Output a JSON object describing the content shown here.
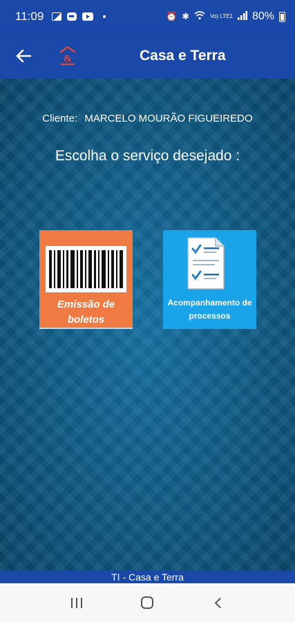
{
  "status_bar": {
    "time": "11:09",
    "battery": "80%",
    "network": "Vo) LTE1",
    "icons": [
      "gallery-icon",
      "app-icon",
      "youtube-icon",
      "alarm-icon",
      "bluetooth-icon",
      "wifi-icon",
      "signal-icon",
      "battery-icon"
    ]
  },
  "app_bar": {
    "title": "Casa e Terra",
    "back_icon": "arrow-left-icon",
    "logo": "casa-e-terra-logo"
  },
  "main": {
    "client_label": "Cliente:",
    "client_name": "MARCELO MOURÃO FIGUEIREDO",
    "prompt": "Escolha o serviço desejado :",
    "tiles": [
      {
        "label": "Emissão de boletos",
        "icon": "barcode-icon",
        "color": "#ef7b43"
      },
      {
        "label": "Acompanhamento de processos",
        "icon": "checklist-document-icon",
        "color": "#1aa3e8"
      }
    ]
  },
  "footer": {
    "text": "TI - Casa e Terra"
  },
  "colors": {
    "primary": "#1a48a8",
    "background": "#0f6292",
    "accent_logo": "#e0473b"
  }
}
